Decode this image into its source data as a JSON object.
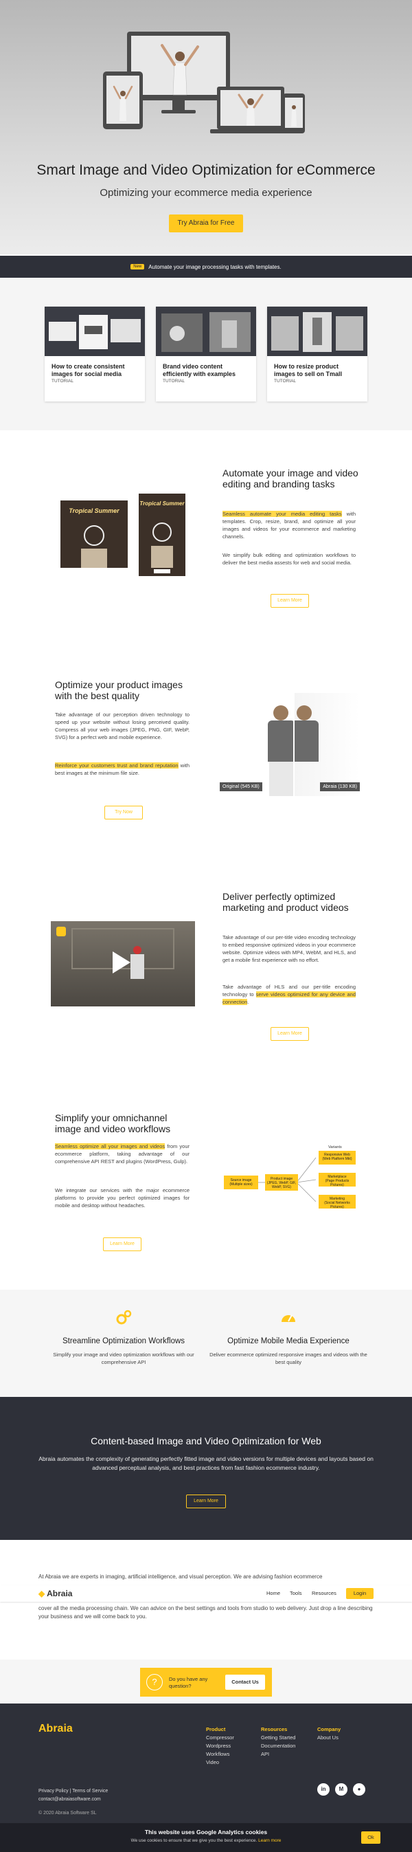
{
  "hero": {
    "title": "Smart Image and Video Optimization for eCommerce",
    "subtitle": "Optimizing your ecommerce media experience",
    "cta": "Try Abraia for Free"
  },
  "banner": {
    "badge": "New",
    "text": "Automate your image processing tasks with templates."
  },
  "tutorials": [
    {
      "title": "How to create consistent images for social media",
      "tag": "TUTORIAL"
    },
    {
      "title": "Brand video content efficiently with examples",
      "tag": "TUTORIAL"
    },
    {
      "title": "How to resize product images to sell on Tmall",
      "tag": "TUTORIAL"
    }
  ],
  "automate": {
    "title": "Automate your image and video editing and branding tasks",
    "highlight": "Seamless automate your media editing tasks",
    "text1_rest": " with templates. Crop, resize, brand, and optimize all your images and videos for your ecommerce and marketing channels.",
    "text2": "We simplify bulk editing and optimization workflows to deliver the best media assests for web and social media.",
    "button": "Learn More",
    "card1_text": "Tropical Summer",
    "card2_text": "Tropical Summer"
  },
  "optimize": {
    "title": "Optimize your product images with the best quality",
    "text1": "Take advantage of our perception driven technology to speed up your website without losing perceived quality. Compress all your web images (JPEG, PNG, GIF, WebP, SVG) for a perfect web and mobile experience.",
    "highlight": "Reinforce your customers trust and brand reputation",
    "text2_rest": " with best images at the minimum file size.",
    "button": "Try Now",
    "label_left": "Original (545 KB)",
    "label_right": "Abraia (130 KB)"
  },
  "video": {
    "title": "Deliver perfectly optimized marketing and product videos",
    "text1": "Take advantage of our per-title video encoding technology to embed responsive optimized videos in your ecommerce website. Optimize videos with MP4, WebM, and HLS, and get a mobile first experience with no effort.",
    "text2_pre": "Take advantage of HLS and our per-title encoding technology to ",
    "highlight": "serve videos optimized for any device and connection",
    "text2_post": ".",
    "button": "Learn More"
  },
  "omnichannel": {
    "title": "Simplify your omnichannel image and video workflows",
    "highlight": "Seamless optimize all your images and videos",
    "text1_rest": " from your ecommerce platform, taking advantage of our comprehensive API REST and plugins (WordPress, Gulp).",
    "text2": "We integrate our services with the major ecommerce platforms to provide you perfect optimized images for mobile and desktop without headaches.",
    "button": "Learn More",
    "diagram": {
      "variants_label": "Variants",
      "source": "Source image",
      "source_sub": "(Multiple sizes)",
      "product": "Product image",
      "product_sub": "(JPEG, WebP, GIF, WebP, SVG)",
      "v1": "Responsive Web",
      "v1_sub": "(Web Platform Mkt)",
      "v2": "Marketplace",
      "v2_sub": "(Page Products Pictures)",
      "v3": "Marketing",
      "v3_sub": "(Social Networks Pictures)"
    }
  },
  "features": [
    {
      "title": "Streamline Optimization Workflows",
      "desc": "Simplify your image and video optimization workflows with our comprehensive API",
      "icon": "gears-icon"
    },
    {
      "title": "Optimize Mobile Media Experience",
      "desc": "Deliver ecommerce optimized responsive images and videos with the best quality",
      "icon": "speedometer-icon"
    }
  ],
  "content_based": {
    "title": "Content-based Image and Video Optimization for Web",
    "desc": "Abraia automates the complexity of generating perfectly fitted image and video versions for multiple devices and layouts based on advanced perceptual analysis, and best practices from fast fashion ecommerce industry.",
    "button": "Learn More"
  },
  "about": {
    "p1": "At Abraia we are experts in imaging, artificial intelligence, and visual perception. We are advising fashion ecommerce",
    "p2": "cover all the media processing chain. We can advice on the best settings and tools from studio to web delivery. Just drop a line describing your business and we will come back to you."
  },
  "navbar": {
    "logo": "Abraia",
    "links": [
      "Home",
      "Tools",
      "Resources"
    ],
    "login": "Login"
  },
  "contact": {
    "line1": "Do you have any",
    "line2": "question?",
    "button": "Contact Us"
  },
  "footer": {
    "logo": "Abraia",
    "product": {
      "heading": "Product",
      "items": [
        "Compressor",
        "Wordpress",
        "Workflows",
        "Video"
      ]
    },
    "resources": {
      "heading": "Resources",
      "items": [
        "Getting Started",
        "Documentation",
        "API"
      ]
    },
    "company": {
      "heading": "Company",
      "items": [
        "About Us"
      ]
    },
    "legal": "Privacy Policy | Terms of Service",
    "email": "contact@abraiasoftware.com",
    "copyright": "© 2020 Abraia Software SL"
  },
  "cookie": {
    "title": "This website uses Google Analytics cookies",
    "desc": "We use cookies to ensure that we give you the best experience.",
    "link": "Learn more",
    "ok": "Ok"
  },
  "colors": {
    "accent": "#ffc81f",
    "dark": "#2e3039"
  }
}
